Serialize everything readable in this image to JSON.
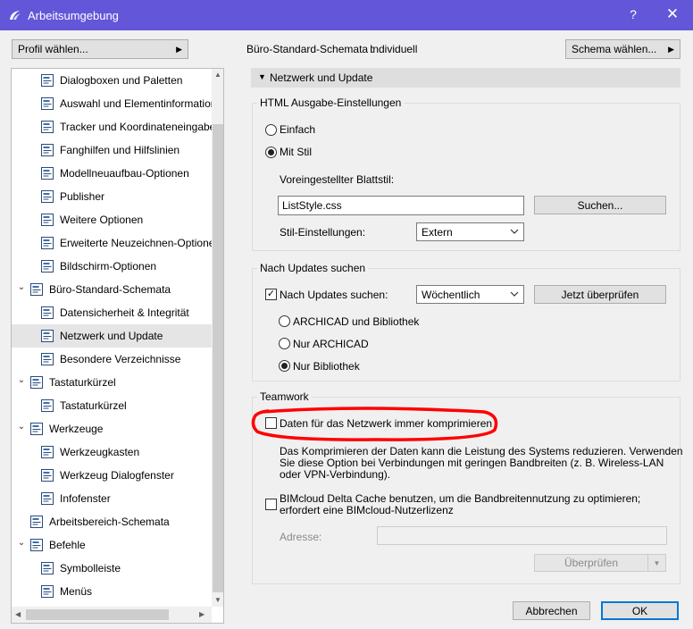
{
  "window": {
    "title": "Arbeitsumgebung",
    "help": "?",
    "close": "✕"
  },
  "profile_button": "Profil wählen...",
  "schema": {
    "label": "Büro-Standard-Schemata :",
    "value": "Individuell",
    "choose_button": "Schema wählen..."
  },
  "tree": [
    {
      "label": "Dialogboxen und Paletten",
      "icon": "dialog-palette-icon"
    },
    {
      "label": "Auswahl und Elementinformation",
      "icon": "selection-icon"
    },
    {
      "label": "Tracker und Koordinateneingabe",
      "icon": "xyz-tracker-icon"
    },
    {
      "label": "Fanghilfen und Hilfslinien",
      "icon": "snap-guide-icon"
    },
    {
      "label": "Modellneuaufbau-Optionen",
      "icon": "model-rebuild-icon"
    },
    {
      "label": "Publisher",
      "icon": "publisher-icon"
    },
    {
      "label": "Weitere Optionen",
      "icon": "sliders-icon"
    },
    {
      "label": "Erweiterte Neuzeichnen-Optionen",
      "icon": "redraw-house-icon"
    },
    {
      "label": "Bildschirm-Optionen",
      "icon": "screen-icon"
    },
    {
      "label": "Büro-Standard-Schemata",
      "icon": "company-schema-icon",
      "expander": "⌄"
    },
    {
      "label": "Datensicherheit & Integrität",
      "icon": "data-safety-icon"
    },
    {
      "label": "Netzwerk und Update",
      "icon": "globe-icon"
    },
    {
      "label": "Besondere Verzeichnisse",
      "icon": "folder-icon"
    },
    {
      "label": "Tastaturkürzel",
      "icon": "keyboard-schema-icon",
      "expander": "⌄"
    },
    {
      "label": "Tastaturkürzel",
      "icon": "keyboard-icon"
    },
    {
      "label": "Werkzeuge",
      "icon": "tools-schema-icon",
      "expander": "⌄"
    },
    {
      "label": "Werkzeugkasten",
      "icon": "toolbox-icon"
    },
    {
      "label": "Werkzeug Dialogfenster",
      "icon": "tool-dialog-icon"
    },
    {
      "label": "Infofenster",
      "icon": "info-box-icon"
    },
    {
      "label": "Arbeitsbereich-Schemata",
      "icon": "workspace-schema-icon"
    },
    {
      "label": "Befehle",
      "icon": "commands-schema-icon",
      "expander": "⌄"
    },
    {
      "label": "Symbolleiste",
      "icon": "toolbar-icon"
    },
    {
      "label": "Menüs",
      "icon": "menus-icon"
    }
  ],
  "panel": {
    "header": "Netzwerk und Update",
    "html_group": {
      "title": "HTML Ausgabe-Einstellungen",
      "opt_simple": "Einfach",
      "opt_style": "Mit Stil",
      "default_style_label": "Voreingestellter Blattstil:",
      "style_file": "ListStyle.css",
      "search_button": "Suchen...",
      "style_settings_label": "Stil-Einstellungen:",
      "style_settings_value": "Extern"
    },
    "updates_group": {
      "title": "Nach Updates suchen",
      "check_label": "Nach Updates suchen:",
      "frequency": "Wöchentlich",
      "check_now_button": "Jetzt überprüfen",
      "opt_both": "ARCHICAD und Bibliothek",
      "opt_archicad": "Nur ARCHICAD",
      "opt_library": "Nur Bibliothek"
    },
    "teamwork_group": {
      "title": "Teamwork",
      "compress_label": "Daten für das Netzwerk immer komprimieren",
      "compress_desc_1": "Das Komprimieren der Daten kann die Leistung des Systems reduzieren. Verwenden",
      "compress_desc_2": "Sie diese Option bei Verbindungen mit geringen Bandbreiten (z. B. Wireless-LAN",
      "compress_desc_3": "oder VPN-Verbindung).",
      "bimcloud_label_1": "BIMcloud Delta Cache benutzen, um die Bandbreitennutzung zu optimieren;",
      "bimcloud_label_2": "erfordert eine BIMcloud-Nutzerlizenz",
      "address_label": "Adresse:",
      "address_value": "",
      "verify_button": "Überprüfen"
    }
  },
  "footer": {
    "cancel": "Abbrechen",
    "ok": "OK"
  },
  "colors": {
    "titlebar": "#6356d8",
    "highlight": "#ff0000",
    "ok_border": "#0078d7"
  }
}
